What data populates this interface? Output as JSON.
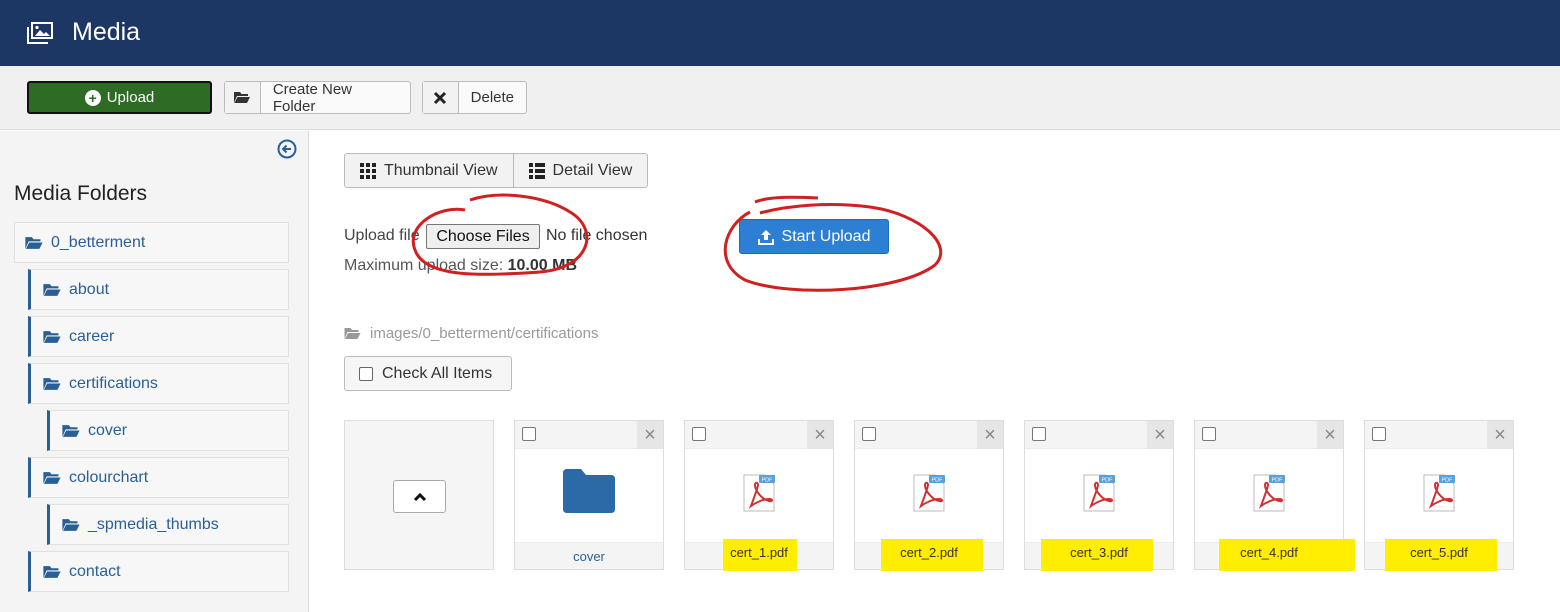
{
  "header": {
    "title": "Media",
    "icon": "media-image-icon",
    "bg_color": "#1c3764"
  },
  "toolbar": {
    "upload_label": "Upload",
    "create_folder_label": "Create New Folder",
    "delete_label": "Delete",
    "upload_color": "#2e6b25"
  },
  "sidebar": {
    "title": "Media Folders",
    "folders": [
      {
        "label": "0_betterment",
        "level": 0
      },
      {
        "label": "about",
        "level": 1
      },
      {
        "label": "career",
        "level": 1
      },
      {
        "label": "certifications",
        "level": 1
      },
      {
        "label": "cover",
        "level": 2
      },
      {
        "label": "colourchart",
        "level": 1
      },
      {
        "label": "_spmedia_thumbs",
        "level": 2
      },
      {
        "label": "contact",
        "level": 1
      }
    ]
  },
  "main": {
    "thumbnail_view": "Thumbnail View",
    "detail_view": "Detail View",
    "upload_file_label": "Upload file",
    "choose_files": "Choose Files",
    "no_file": "No file chosen",
    "max_size_label": "Maximum upload size:",
    "max_size_value": "10.00 MB",
    "start_upload": "Start Upload",
    "start_upload_color": "#2d7fd4",
    "path": "images/0_betterment/certifications",
    "check_all": "Check All Items"
  },
  "tiles": [
    {
      "name": "cover",
      "kind": "folder"
    },
    {
      "name": "cert_1.pdf",
      "kind": "pdf"
    },
    {
      "name": "cert_2.pdf",
      "kind": "pdf"
    },
    {
      "name": "cert_3.pdf",
      "kind": "pdf"
    },
    {
      "name": "cert_4.pdf",
      "kind": "pdf"
    },
    {
      "name": "cert_5.pdf",
      "kind": "pdf"
    }
  ]
}
